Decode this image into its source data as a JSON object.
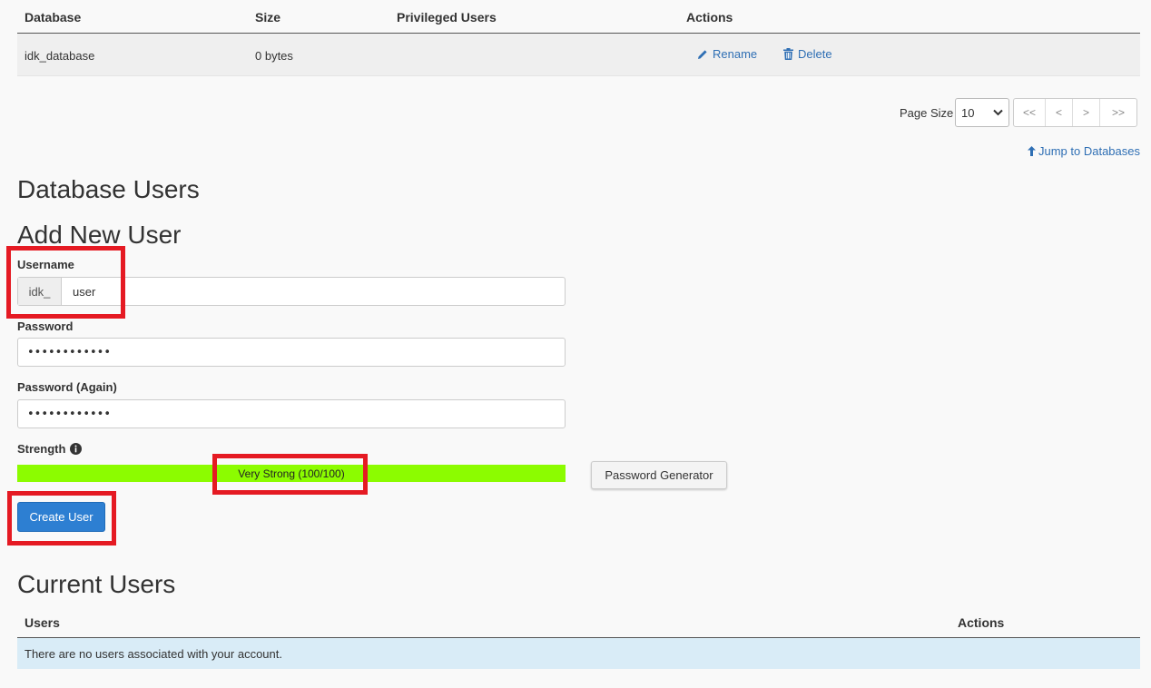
{
  "databases_table": {
    "headers": [
      "Database",
      "Size",
      "Privileged Users",
      "Actions"
    ],
    "rows": [
      {
        "database": "idk_database",
        "size": "0 bytes",
        "privileged_users": "",
        "rename_label": "Rename",
        "delete_label": "Delete"
      }
    ]
  },
  "pager": {
    "page_size_label": "Page Size",
    "page_size_value": "10",
    "buttons": [
      "<<",
      "<",
      ">",
      ">>"
    ]
  },
  "jump_link": "Jump to Databases",
  "section_title": "Database Users",
  "add_user": {
    "title": "Add New User",
    "username_label": "Username",
    "username_prefix": "idk_",
    "username_value": "user",
    "password_label": "Password",
    "password_value": "••••••••••••",
    "password_again_label": "Password (Again)",
    "password_again_value": "••••••••••••",
    "strength_label": "Strength",
    "strength_text": "Very Strong (100/100)",
    "strength_percent": 100,
    "strength_color": "#8cfc00",
    "password_generator_label": "Password Generator",
    "create_button_label": "Create User"
  },
  "current_users": {
    "title": "Current Users",
    "headers": [
      "Users",
      "Actions"
    ],
    "empty_message": "There are no users associated with your account."
  },
  "colors": {
    "link": "#2f6fb4",
    "primary_button": "#2d7fd2",
    "highlight": "#e51a23",
    "info_row": "#d9ecf7"
  },
  "icons": {
    "rename": "pencil-icon",
    "delete": "trash-icon",
    "jump": "arrow-up-icon",
    "strength_info": "info-icon",
    "select": "chevron-down-icon"
  }
}
